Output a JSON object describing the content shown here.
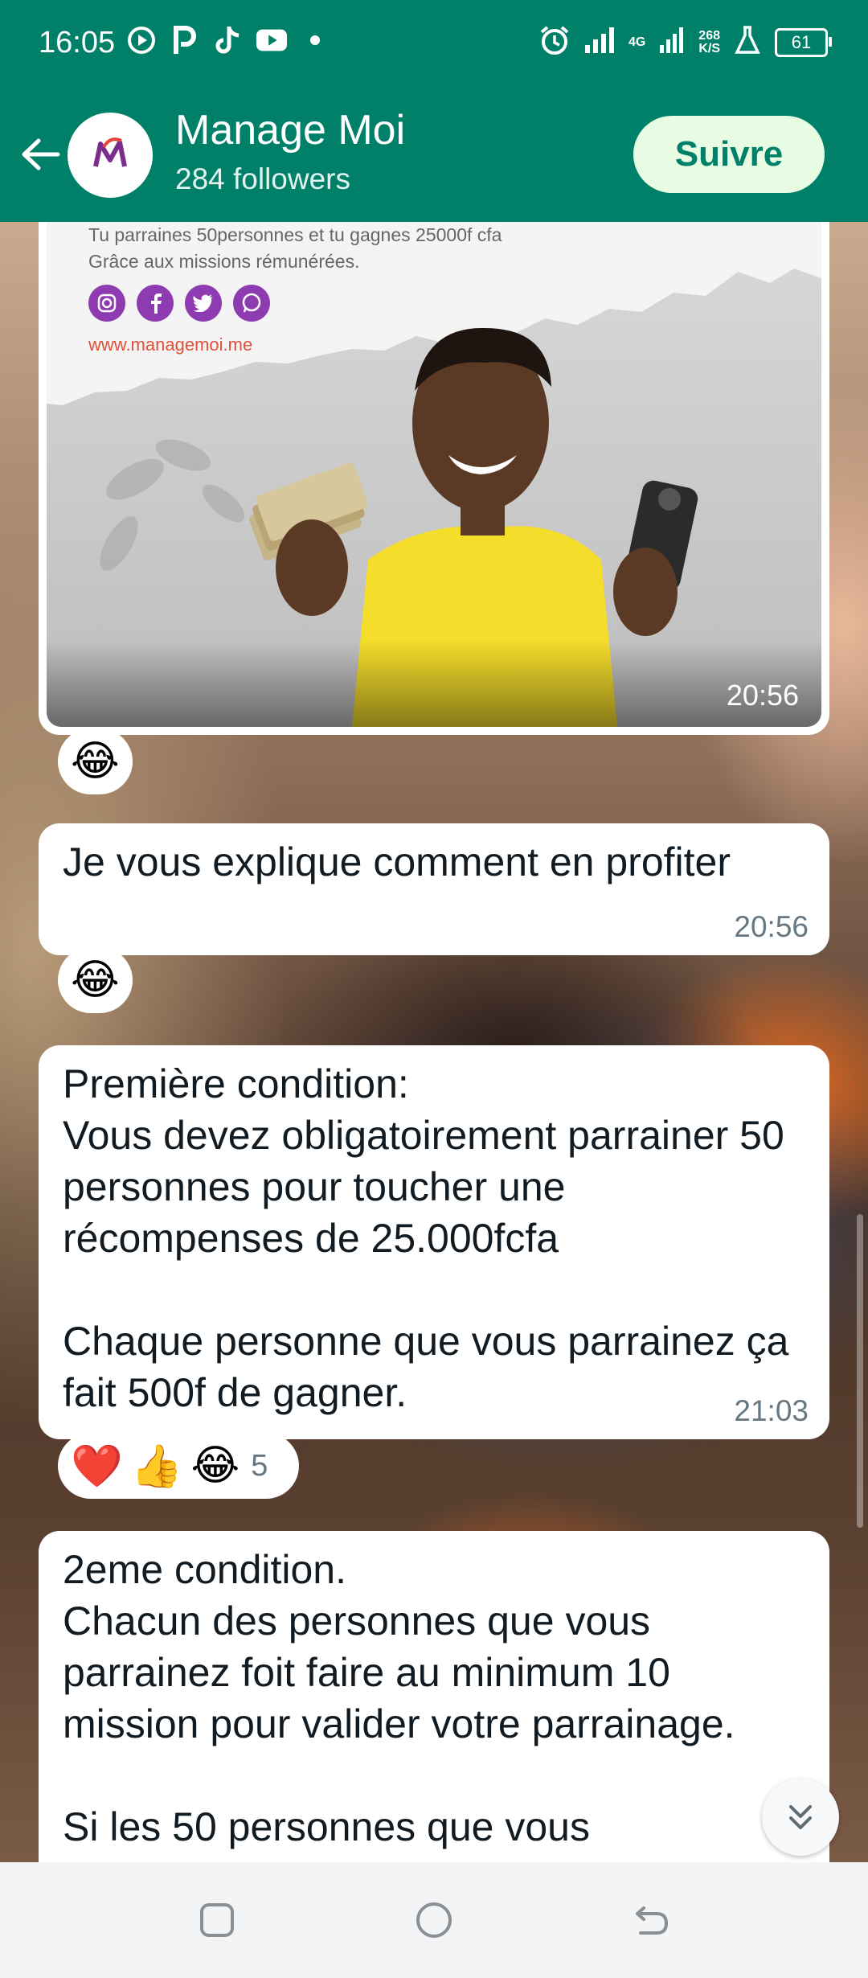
{
  "status_bar": {
    "time": "16:05",
    "left_icons": [
      "screen-record-icon",
      "p-app-icon",
      "tiktok-icon",
      "youtube-icon",
      "dot-icon"
    ],
    "network_type": "4G",
    "speed_value": "268",
    "speed_unit": "K/S",
    "battery": "61"
  },
  "header": {
    "channel_name": "Manage Moi",
    "followers": "284 followers",
    "follow_label": "Suivre"
  },
  "image_message": {
    "caption_lines": [
      "Tu parraines 50personnes et tu gagnes 25000f cfa",
      "Grâce aux missions rémunérées."
    ],
    "url": "www.managemoi.me",
    "time": "20:56",
    "reaction": "😂"
  },
  "messages": [
    {
      "text": "Je vous explique comment en profiter",
      "time": "20:56",
      "reactions": [
        "😂"
      ]
    },
    {
      "text": "Première condition:\nVous devez obligatoirement parrainer 50 personnes pour toucher une récompenses de 25.000fcfa\n\nChaque personne que vous parrainez ça fait 500f de gagner.",
      "time": "21:03",
      "reactions": [
        "❤️",
        "👍",
        "😂"
      ],
      "reaction_count": "5"
    },
    {
      "text": "2eme condition.\nChacun des personnes que vous parrainez foit faire au minimum 10 mission pour valider votre parrainage.\n\nSi les 50 personnes que vous"
    }
  ],
  "colors": {
    "header": "#008069",
    "follow_button_bg": "#e7fce3",
    "bubble": "#ffffff",
    "timestamp": "#667781"
  }
}
